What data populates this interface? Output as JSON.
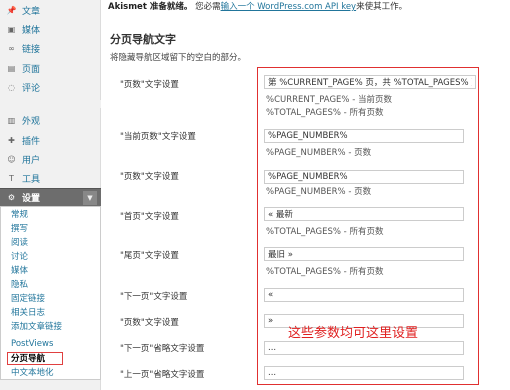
{
  "notice": {
    "title": "Akismet 准备就绪。",
    "text_before": "您必需",
    "link": "输入一个 WordPress.com API key",
    "text_after": "来使其工作。"
  },
  "sidebar": {
    "items": [
      {
        "label": "文章",
        "icon": "pushpin-icon"
      },
      {
        "label": "媒体",
        "icon": "media-icon"
      },
      {
        "label": "链接",
        "icon": "link-icon"
      },
      {
        "label": "页面",
        "icon": "page-icon"
      },
      {
        "label": "评论",
        "icon": "comment-icon"
      },
      {
        "label": "外观",
        "icon": "appearance-icon"
      },
      {
        "label": "插件",
        "icon": "plugin-icon"
      },
      {
        "label": "用户",
        "icon": "users-icon"
      },
      {
        "label": "工具",
        "icon": "tools-icon"
      },
      {
        "label": "设置",
        "icon": "settings-icon"
      }
    ],
    "submenu": [
      "常规",
      "撰写",
      "阅读",
      "讨论",
      "媒体",
      "隐私",
      "固定链接",
      "相关日志",
      "添加文章链接",
      "PostViews",
      "分页导航",
      "中文本地化"
    ]
  },
  "main": {
    "title": "分页导航文字",
    "description": "将隐藏导航区域留下的空白的部分。",
    "rows": [
      {
        "label": "\"页数\"文字设置",
        "value": "第 %CURRENT_PAGE% 页，共 %TOTAL_PAGES% 页",
        "desc1": "%CURRENT_PAGE% - 当前页数",
        "desc2": "%TOTAL_PAGES% - 所有页数"
      },
      {
        "label": "\"当前页数\"文字设置",
        "value": "%PAGE_NUMBER%",
        "desc1": "%PAGE_NUMBER% - 页数"
      },
      {
        "label": "\"页数\"文字设置",
        "value": "%PAGE_NUMBER%",
        "desc1": "%PAGE_NUMBER% - 页数"
      },
      {
        "label": "\"首页\"文字设置",
        "value": "« 最新",
        "desc1": "%TOTAL_PAGES% - 所有页数"
      },
      {
        "label": "\"尾页\"文字设置",
        "value": "最旧 »",
        "desc1": "%TOTAL_PAGES% - 所有页数"
      },
      {
        "label": "\"下一页\"文字设置",
        "value": "«"
      },
      {
        "label": "\"页数\"文字设置",
        "value": "»"
      },
      {
        "label": "\"下一页\"省略文字设置",
        "value": "..."
      },
      {
        "label": "\"上一页\"省略文字设置",
        "value": "..."
      }
    ]
  },
  "annotation": "这些参数均可这里设置",
  "colors": {
    "link": "#21759b",
    "highlight": "#e03030",
    "active_menu": "#6d6d6d"
  }
}
